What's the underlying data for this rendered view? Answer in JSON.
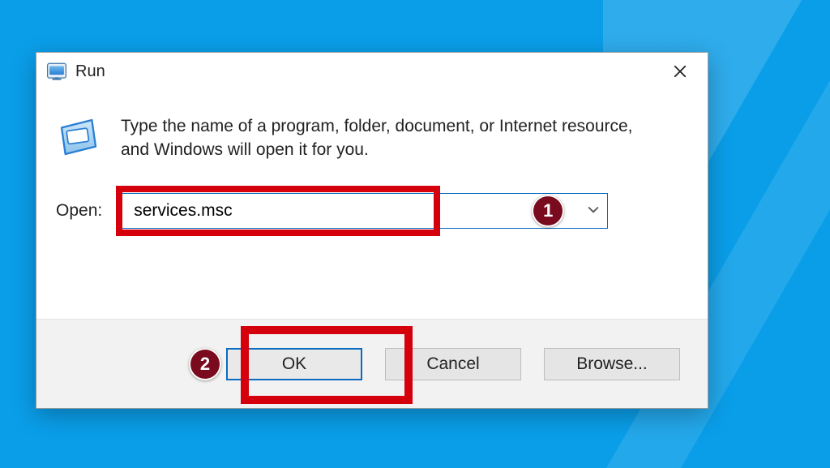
{
  "dialog": {
    "title": "Run",
    "description": "Type the name of a program, folder, document, or Internet resource, and Windows will open it for you.",
    "open_label": "Open:",
    "input_value": "services.msc",
    "buttons": {
      "ok": "OK",
      "cancel": "Cancel",
      "browse": "Browse..."
    }
  },
  "annotations": {
    "callout1": "1",
    "callout2": "2"
  }
}
